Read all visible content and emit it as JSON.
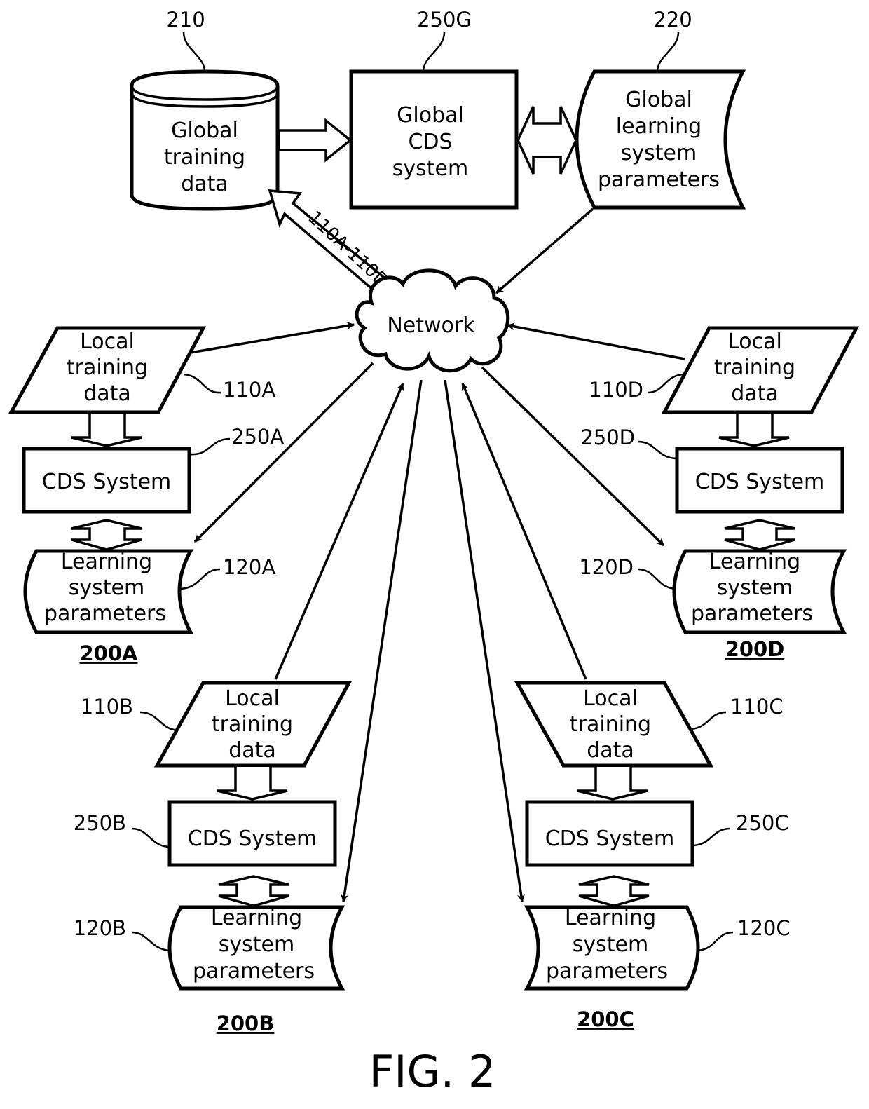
{
  "figure": {
    "caption": "FIG. 2"
  },
  "global": {
    "training_data": {
      "ref": "210",
      "lines": [
        "Global",
        "training",
        "data"
      ]
    },
    "cds_system": {
      "ref": "250G",
      "lines": [
        "Global",
        "CDS",
        "system"
      ]
    },
    "parameters": {
      "ref": "220",
      "lines": [
        "Global",
        "learning",
        "system",
        "parameters"
      ]
    },
    "upload_arrow_label": "110A-110D"
  },
  "network": {
    "label": "Network"
  },
  "sites": [
    {
      "id": "A",
      "group_label": "200A",
      "local_data": {
        "ref": "110A",
        "lines": [
          "Local",
          "training",
          "data"
        ]
      },
      "cds": {
        "ref": "250A",
        "label": "CDS System"
      },
      "params": {
        "ref": "120A",
        "lines": [
          "Learning",
          "system",
          "parameters"
        ]
      }
    },
    {
      "id": "B",
      "group_label": "200B",
      "local_data": {
        "ref": "110B",
        "lines": [
          "Local",
          "training",
          "data"
        ]
      },
      "cds": {
        "ref": "250B",
        "label": "CDS System"
      },
      "params": {
        "ref": "120B",
        "lines": [
          "Learning",
          "system",
          "parameters"
        ]
      }
    },
    {
      "id": "C",
      "group_label": "200C",
      "local_data": {
        "ref": "110C",
        "lines": [
          "Local",
          "training",
          "data"
        ]
      },
      "cds": {
        "ref": "250C",
        "label": "CDS System"
      },
      "params": {
        "ref": "120C",
        "lines": [
          "Learning",
          "system",
          "parameters"
        ]
      }
    },
    {
      "id": "D",
      "group_label": "200D",
      "local_data": {
        "ref": "110D",
        "lines": [
          "Local",
          "training",
          "data"
        ]
      },
      "cds": {
        "ref": "250D",
        "label": "CDS System"
      },
      "params": {
        "ref": "120D",
        "lines": [
          "Learning",
          "system",
          "parameters"
        ]
      }
    }
  ]
}
